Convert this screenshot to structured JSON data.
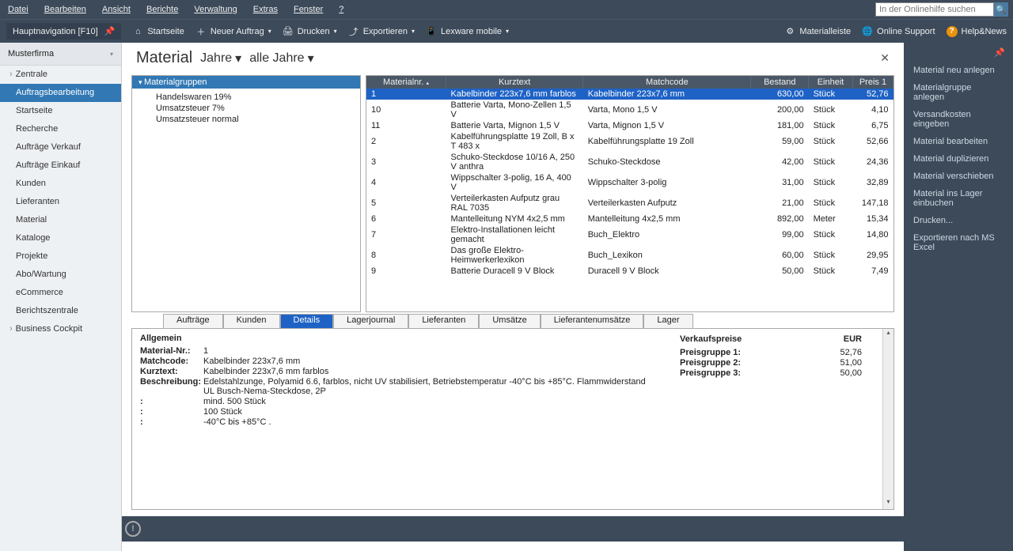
{
  "menu": {
    "items": [
      "Datei",
      "Bearbeiten",
      "Ansicht",
      "Berichte",
      "Verwaltung",
      "Extras",
      "Fenster",
      "?"
    ],
    "search_placeholder": "In der Onlinehilfe suchen"
  },
  "toolbar": {
    "nav": "Hauptnavigation [F10]",
    "start": "Startseite",
    "neuer": "Neuer Auftrag",
    "drucken": "Drucken",
    "export": "Exportieren",
    "mobile": "Lexware mobile",
    "matleiste": "Materialleiste",
    "support": "Online Support",
    "help": "Help&News"
  },
  "sidebar": {
    "firm": "Musterfirma",
    "items": [
      {
        "label": "Zentrale",
        "parent": true
      },
      {
        "label": "Auftragsbearbeitung",
        "active": true
      },
      {
        "label": "Startseite"
      },
      {
        "label": "Recherche"
      },
      {
        "label": "Aufträge Verkauf"
      },
      {
        "label": "Aufträge Einkauf"
      },
      {
        "label": "Kunden"
      },
      {
        "label": "Lieferanten"
      },
      {
        "label": "Material"
      },
      {
        "label": "Kataloge"
      },
      {
        "label": "Projekte"
      },
      {
        "label": "Abo/Wartung"
      },
      {
        "label": "eCommerce"
      },
      {
        "label": "Berichtszentrale"
      },
      {
        "label": "Business Cockpit",
        "parent": true
      }
    ]
  },
  "page": {
    "title": "Material",
    "dropdown1": "Jahre",
    "dropdown2": "alle Jahre"
  },
  "tree": {
    "head": "Materialgruppen",
    "items": [
      "Handelswaren 19%",
      "Umsatzsteuer 7%",
      "Umsatzsteuer normal"
    ]
  },
  "grid": {
    "columns": [
      "Materialnr.",
      "Kurztext",
      "Matchcode",
      "Bestand",
      "Einheit",
      "Preis 1"
    ],
    "rows": [
      {
        "nr": "1",
        "kurz": "Kabelbinder 223x7,6 mm farblos",
        "match": "Kabelbinder 223x7,6 mm",
        "best": "630,00",
        "ein": "Stück",
        "p1": "52,76",
        "sel": true
      },
      {
        "nr": "10",
        "kurz": "Batterie Varta, Mono-Zellen 1,5 V",
        "match": "Varta, Mono 1,5 V",
        "best": "200,00",
        "ein": "Stück",
        "p1": "4,10"
      },
      {
        "nr": "11",
        "kurz": "Batterie Varta, Mignon 1,5 V",
        "match": "Varta, Mignon 1,5 V",
        "best": "181,00",
        "ein": "Stück",
        "p1": "6,75"
      },
      {
        "nr": "2",
        "kurz": "Kabelführungsplatte 19 Zoll,  B x T 483 x ",
        "match": "Kabelführungsplatte 19 Zoll",
        "best": "59,00",
        "ein": "Stück",
        "p1": "52,66"
      },
      {
        "nr": "3",
        "kurz": "Schuko-Steckdose 10/16 A, 250 V anthra",
        "match": "Schuko-Steckdose",
        "best": "42,00",
        "ein": "Stück",
        "p1": "24,36"
      },
      {
        "nr": "4",
        "kurz": "Wippschalter 3-polig, 16 A, 400 V",
        "match": "Wippschalter 3-polig",
        "best": "31,00",
        "ein": "Stück",
        "p1": "32,89"
      },
      {
        "nr": "5",
        "kurz": "Verteilerkasten Aufputz grau RAL 7035",
        "match": "Verteilerkasten Aufputz",
        "best": "21,00",
        "ein": "Stück",
        "p1": "147,18"
      },
      {
        "nr": "6",
        "kurz": "Mantelleitung NYM 4x2,5 mm",
        "match": "Mantelleitung 4x2,5 mm",
        "best": "892,00",
        "ein": "Meter",
        "p1": "15,34"
      },
      {
        "nr": "7",
        "kurz": "Elektro-Installationen leicht gemacht",
        "match": "Buch_Elektro",
        "best": "99,00",
        "ein": "Stück",
        "p1": "14,80"
      },
      {
        "nr": "8",
        "kurz": "Das große Elektro-Heimwerkerlexikon",
        "match": "Buch_Lexikon",
        "best": "60,00",
        "ein": "Stück",
        "p1": "29,95"
      },
      {
        "nr": "9",
        "kurz": "Batterie Duracell 9 V Block",
        "match": "Duracell 9 V Block",
        "best": "50,00",
        "ein": "Stück",
        "p1": "7,49"
      }
    ]
  },
  "tabs": [
    "Aufträge",
    "Kunden",
    "Details",
    "Lagerjournal",
    "Lieferanten",
    "Umsätze",
    "Lieferantenumsätze",
    "Lager"
  ],
  "details": {
    "head_left": "Allgemein",
    "head_right": "Verkaufspreise",
    "head_right_cur": "EUR",
    "left": [
      {
        "k": "Material-Nr.:",
        "v": "1"
      },
      {
        "k": "Matchcode:",
        "v": "Kabelbinder 223x7,6 mm"
      },
      {
        "k": "Kurztext:",
        "v": "Kabelbinder 223x7,6 mm farblos"
      },
      {
        "k": "Beschreibung:",
        "v": "Edelstahlzunge, Polyamid 6.6, farblos, nicht UV stabilisiert, Betriebstemperatur -40°C bis +85°C. Flammwiderstand UL Busch-Nema-Steckdose, 2P"
      },
      {
        "k": ":",
        "v": "mind. 500 Stück"
      },
      {
        "k": ":",
        "v": "100 Stück"
      },
      {
        "k": ":",
        "v": "-40°C bis +85°C ."
      }
    ],
    "right": [
      {
        "k": "Preisgruppe 1:",
        "v": "52,76"
      },
      {
        "k": "Preisgruppe 2:",
        "v": "51,00"
      },
      {
        "k": "Preisgruppe 3:",
        "v": "50,00"
      }
    ]
  },
  "rside": {
    "actions": [
      "Material neu anlegen",
      "Materialgruppe anlegen",
      "Versandkosten eingeben",
      "Material bearbeiten",
      "Material duplizieren",
      "Material verschieben",
      "Material ins Lager einbuchen",
      "Drucken...",
      "Exportieren nach MS Excel"
    ]
  }
}
